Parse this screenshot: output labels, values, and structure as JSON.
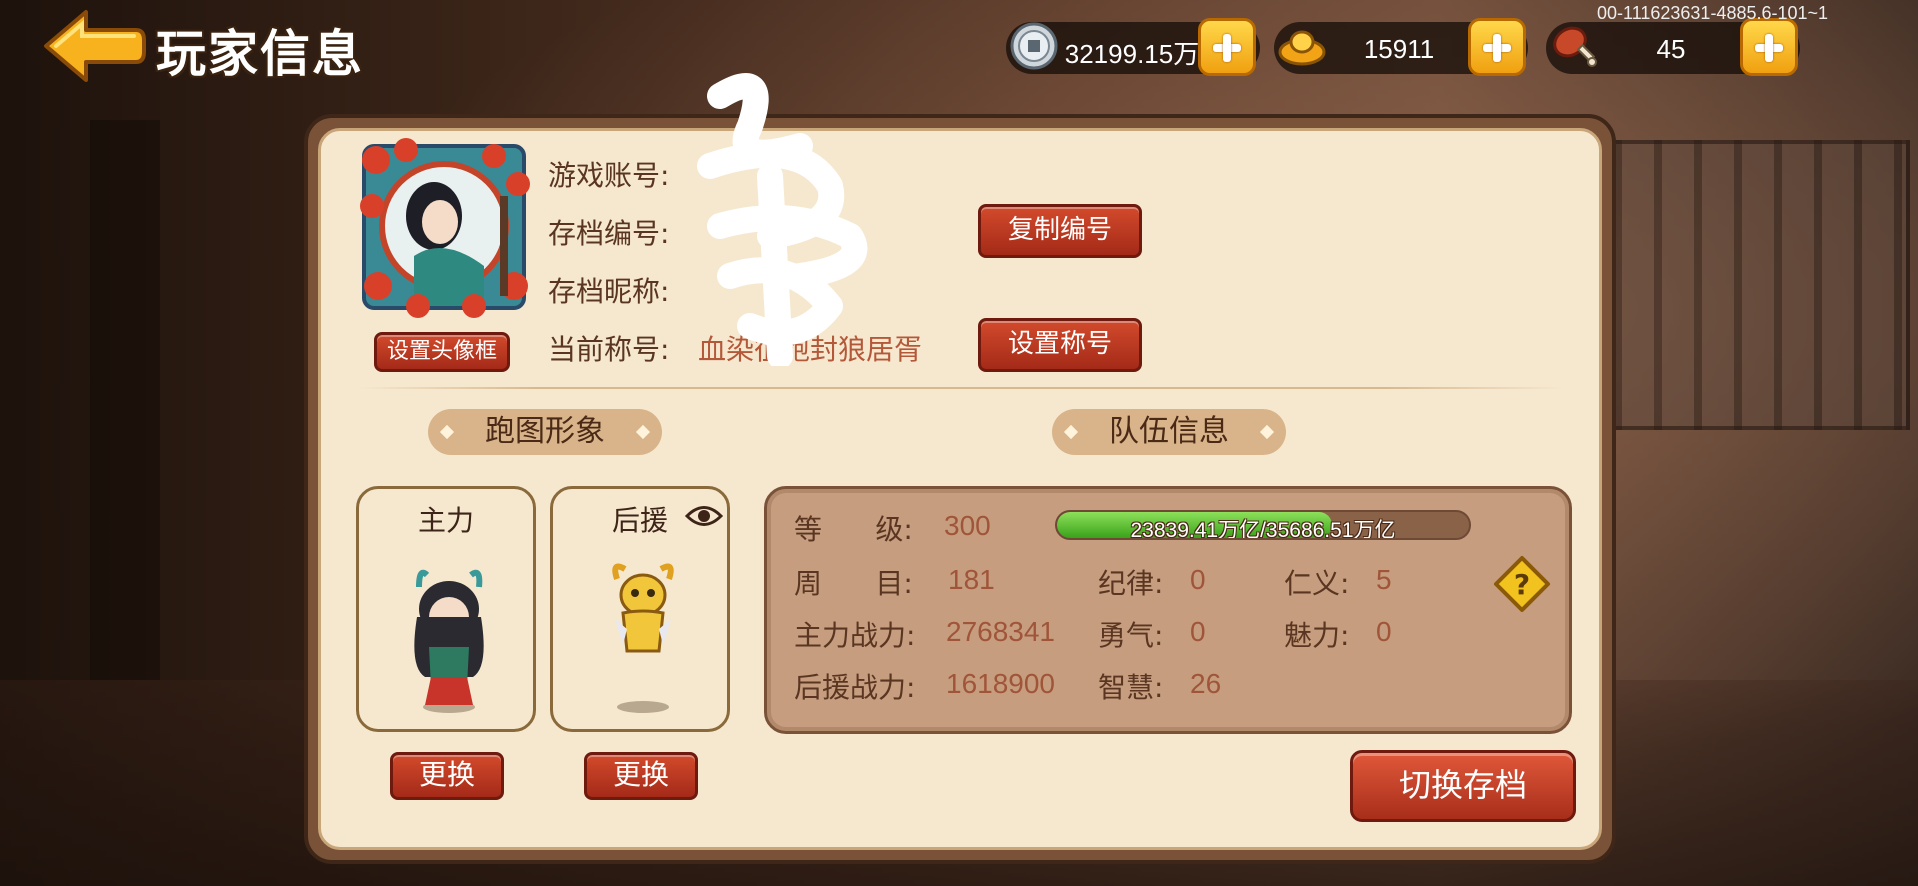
{
  "header": {
    "title": "玩家信息",
    "back_icon": "back-arrow-icon",
    "version": "00-111623631-4885.6-101~1"
  },
  "currencies": [
    {
      "name": "silver",
      "icon": "coin-icon",
      "value": "32199.15万"
    },
    {
      "name": "gold",
      "icon": "gold-ingot-icon",
      "value": "15911"
    },
    {
      "name": "stamina",
      "icon": "meat-icon",
      "value": "45"
    }
  ],
  "profile": {
    "account_label": "游戏账号:",
    "account_value": "",
    "save_id_label": "存档编号:",
    "save_id_value": "",
    "nickname_label": "存档昵称:",
    "nickname_value": "",
    "title_label": "当前称号:",
    "title_value": "血染征袍封狼居胥",
    "copy_button": "复制编号",
    "set_title_button": "设置称号",
    "set_frame_button": "设置头像框"
  },
  "sections": {
    "map_image": "跑图形象",
    "team_info": "队伍信息"
  },
  "characters": {
    "main_label": "主力",
    "support_label": "后援",
    "change_button": "更换"
  },
  "team": {
    "level_label": "等      级:",
    "level_value": "300",
    "xp_text": "23839.41万亿/35686.51万亿",
    "xp_fraction": 0.668,
    "cycle_label": "周      目:",
    "cycle_value": "181",
    "main_power_label": "主力战力:",
    "main_power_value": "2768341",
    "support_power_label": "后援战力:",
    "support_power_value": "1618900",
    "discipline_label": "纪律:",
    "discipline_value": "0",
    "courage_label": "勇气:",
    "courage_value": "0",
    "wisdom_label": "智慧:",
    "wisdom_value": "26",
    "benevolence_label": "仁义:",
    "benevolence_value": "5",
    "charm_label": "魅力:",
    "charm_value": "0"
  },
  "switch_save_button": "切换存档"
}
